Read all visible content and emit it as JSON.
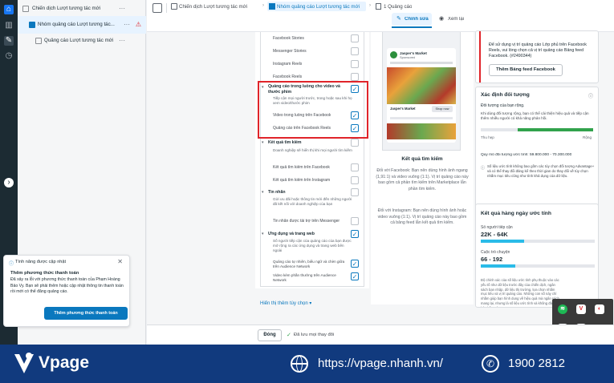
{
  "tree": {
    "campaign": "Chiến dịch Lượt tương tác mới",
    "adset": "Nhóm quảng cáo Lượt tương tác...",
    "ad": "Quảng cáo Lượt tương tác mới",
    "more": "···"
  },
  "toast": {
    "header": "Tính năng được cập nhật",
    "title": "Thêm phương thức thanh toán",
    "body": "Đã xảy ra lỗi với phương thức thanh toán của Phạm Hoàng Bảo Vy. Bạn sẽ phải thêm hoặc cập nhật thông tin thanh toán rồi mới có thể đăng quảng cáo.",
    "button": "Thêm phương thức thanh toán"
  },
  "topbar": {
    "crumb1": "Chiến dịch Lượt tương tác mới",
    "crumb2": "Nhóm quảng cáo Lượt tương tác mới",
    "crumb3": "1 Quảng cáo",
    "edit_tab": "Chỉnh sửa",
    "view_tab": "Xem lại"
  },
  "placements": {
    "top_items": [
      "Facebook Stories",
      "Messenger Stories",
      "Instagram Reels",
      "Facebook Reels"
    ],
    "instream_title": "Quảng cáo trong luồng cho video và thước phim",
    "instream_desc": "Tiếp cận mọi người trước, trong hoặc sau khi họ xem video/thước phim",
    "instream_items": [
      "Video trong luồng trên Facebook",
      "Quảng cáo trên Facebook Reels"
    ],
    "search_title": "Kết quả tìm kiếm",
    "search_desc": "Doanh nghiệp sẽ hiển thị khi mọi người tìm kiếm",
    "search_items": [
      "Kết quả tìm kiếm trên Facebook",
      "Kết quả tìm kiếm trên Instagram"
    ],
    "msg_title": "Tin nhắn",
    "msg_desc": "Gửi ưu đãi hoặc thông tin mới đến những người đã kết nối với doanh nghiệp của bạn",
    "msg_items": [
      "Tin nhắn được tài trợ trên Messenger"
    ],
    "apps_title": "Ứng dụng và trang web",
    "apps_desc": "Số người tiếp cận của quảng cáo của bạn được mở rộng ra các ứng dụng và trang web bên ngoài",
    "apps_items": [
      "Quảng cáo tự nhiên, biểu ngữ và chèn giữa trên Audience Network",
      "Video kèm phần thưởng trên Audience Network"
    ],
    "show_more": "Hiển thị thêm tùy chọn ▾"
  },
  "preview": {
    "page_name": "Jasper's Market",
    "sponsored": "Sponsored",
    "product": "Jasper's Market",
    "cta": "Shop now",
    "title": "Kết quả tìm kiếm",
    "text1": "Đối với Facebook: Bạn nên dùng hình ảnh ngang (1,91:1) và video vuông (1:1). Vị trí quảng cáo này bao gồm cả phần tìm kiếm trên Marketplace lẫn phần tìm kiếm.",
    "text2": "Đối với Instagram: Bạn nên dùng hình ảnh hoặc video vuông (1:1). Vị trí quảng cáo này bao gồm cả bảng feed lẫn kết quả tìm kiếm."
  },
  "right": {
    "notice": "Để sử dụng vị trí quảng cáo Lớp phủ trên Facebook Reels, vui lòng chọn cả vị trí quảng cáo Bảng feed Facebook. (#2490344)",
    "notice_button": "Thêm Bảng feed Facebook",
    "audience_title": "Xác định đối tượng",
    "audience_status": "Đối tượng của bạn rộng.",
    "audience_desc": "Khi dùng đối tượng rộng, bạn có thể cải thiện hiệu quả và tiếp cận thêm nhiều người có khả năng phản hồi.",
    "narrow": "Thu hẹp",
    "broad": "Rộng",
    "audience_size": "Quy mô đối tượng ước tính: 59.800.000 - 70.300.000",
    "audience_note": "Số liệu ước tính không bao gồm các tùy chọn đối tượng Advantage+ và có thể thay đổi đáng kể theo thời gian do thay đổi về tùy chọn nhắm mục tiêu cũng như tính khả dụng của dữ liệu.",
    "daily_title": "Kết quả hàng ngày ước tính",
    "reach_label": "Số người tiếp cận",
    "reach_value": "22K - 64K",
    "conv_label": "Cuộc trò chuyện",
    "conv_value": "66 - 192",
    "reach_fill": 0.38,
    "conv_fill": 0.3,
    "daily_note": "Độ chính xác của số liệu ước tính phụ thuộc vào các yếu tố như dữ liệu trước đây của chiến dịch, ngân sách bạn nhập, dữ liệu thị trường, lựa chọn nhắm mục tiêu và vị trí quảng cáo. Những con số này chỉ nhằm giúp bạn hình dung về hiệu quả mà ngân sách mang lại, nhưng là số liệu ước tính và không đảm bảo kết quả."
  },
  "savebar": {
    "close": "Đóng",
    "saved": "Đã lưu mọi thay đổi"
  },
  "banner": {
    "brand": "Vpage",
    "url": "https://vpage.nhanh.vn/",
    "phone": "1900 2812"
  },
  "colors": {
    "accent": "#0a78be",
    "highlight": "#e0242a",
    "banner": "#113a7e",
    "progress": "#31a24c"
  }
}
